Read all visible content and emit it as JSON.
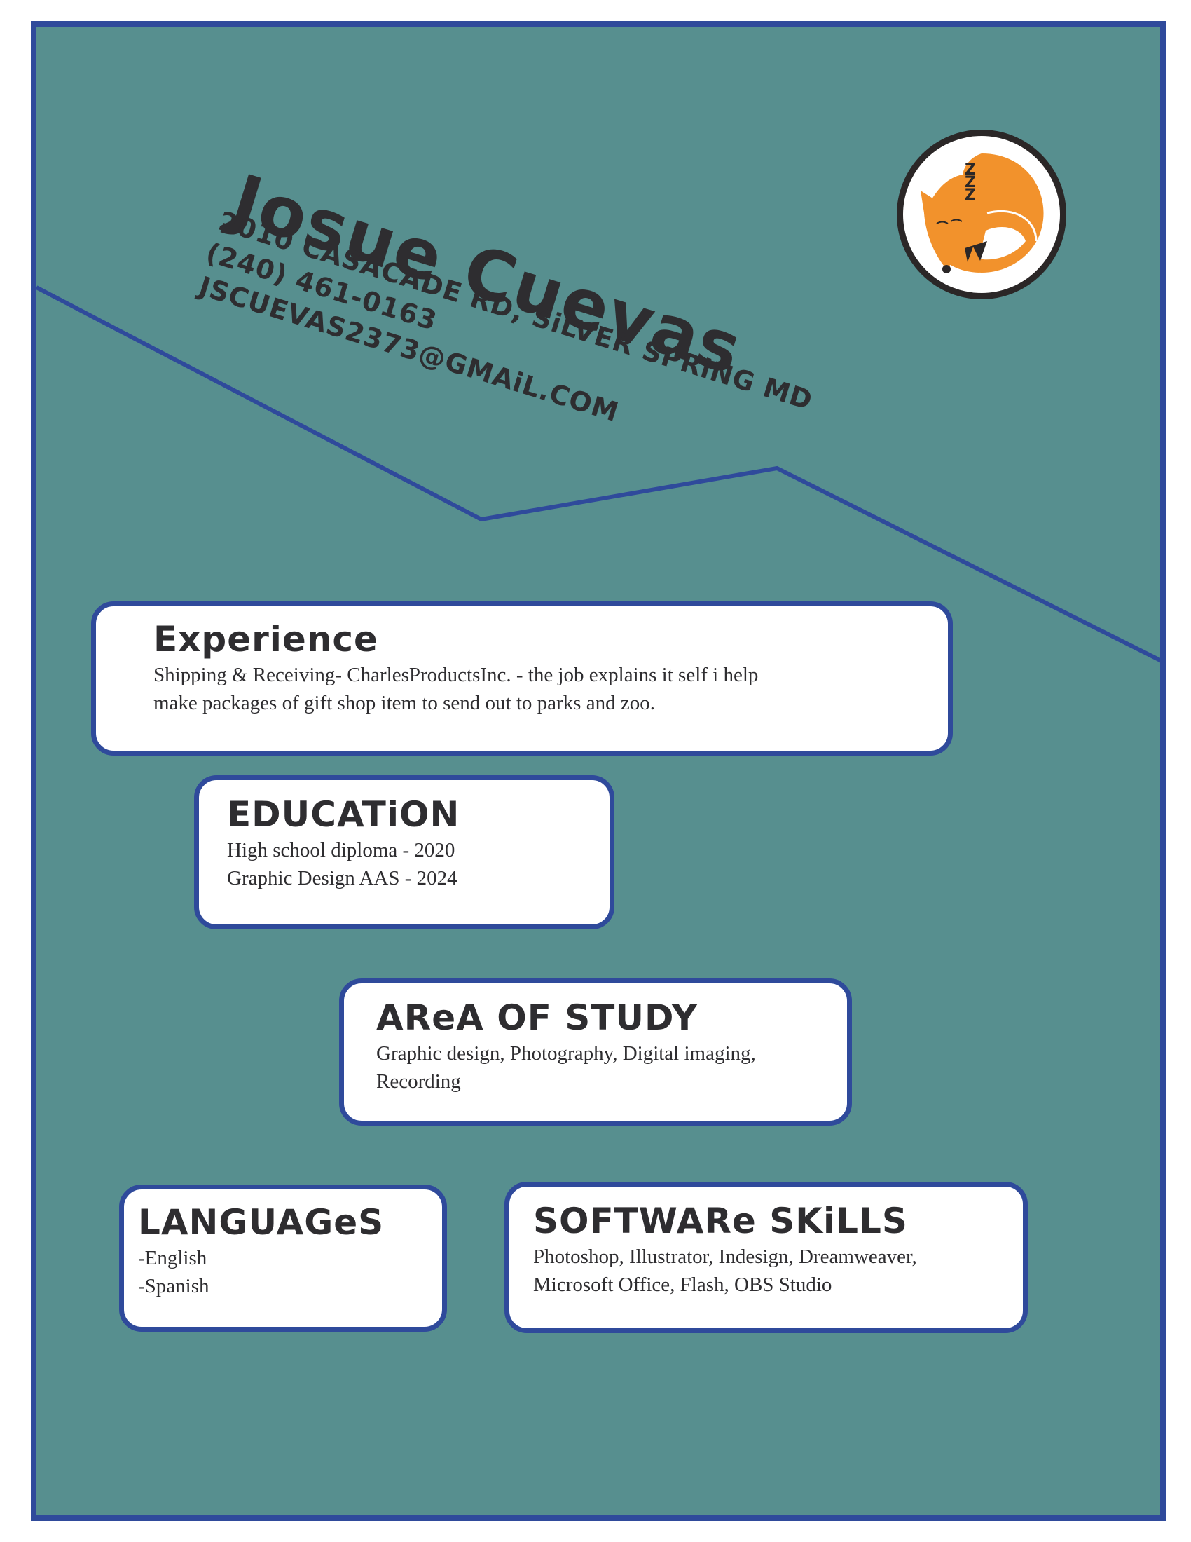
{
  "header": {
    "name": "Josue Cuevas",
    "address": "2010 CASACADE RD, SiLVER SPRiNG MD",
    "phone": "(240) 461-0163",
    "email": "JSCUEVAS2373@GMAiL.COM",
    "logo_icon": "sleeping-fox-icon",
    "logo_zzz": "ZZZ"
  },
  "colors": {
    "background": "#578f8f",
    "border": "#2f4a9b",
    "text": "#2e2d30",
    "fox_orange": "#f2922c"
  },
  "sections": {
    "experience": {
      "title": "Experience",
      "lines": [
        "Shipping & Receiving- CharlesProductsInc. - the job explains it self i help",
        "make packages of gift shop item to send out to parks and zoo."
      ]
    },
    "education": {
      "title": "EDUCATiON",
      "lines": [
        "High school diploma - 2020",
        "Graphic Design AAS - 2024"
      ]
    },
    "area_of_study": {
      "title": "AReA OF STUDY",
      "lines": [
        "Graphic design, Photography, Digital imaging,",
        "Recording"
      ]
    },
    "languages": {
      "title": "LANGUAGeS",
      "lines": [
        "-English",
        "-Spanish"
      ]
    },
    "software_skills": {
      "title": "SOFTWARe SKiLLS",
      "lines": [
        "Photoshop, Illustrator, Indesign, Dreamweaver,",
        "Microsoft Office, Flash, OBS Studio"
      ]
    }
  }
}
